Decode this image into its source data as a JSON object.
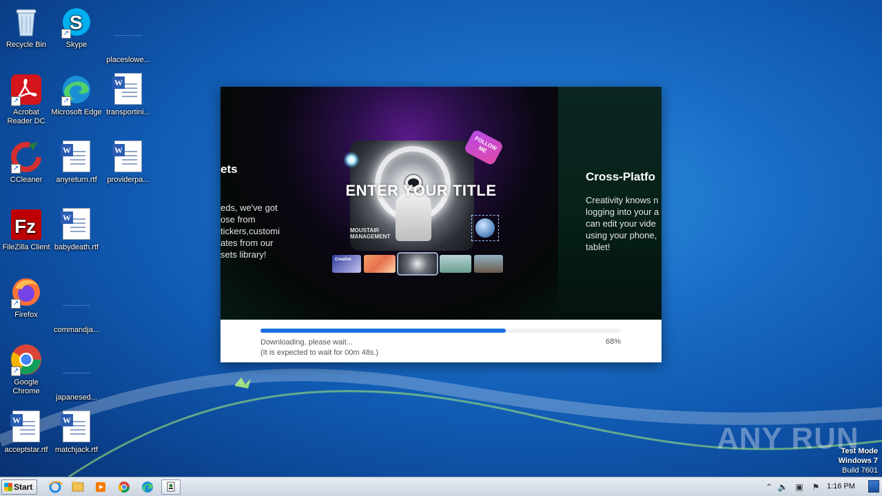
{
  "desktop": {
    "icons": [
      {
        "name": "recycle-bin",
        "label": "Recycle Bin"
      },
      {
        "name": "skype",
        "label": "Skype"
      },
      {
        "name": "placeslowe",
        "label": "placeslowe..."
      },
      {
        "name": "acrobat-reader-dc",
        "label": "Acrobat Reader DC"
      },
      {
        "name": "microsoft-edge",
        "label": "Microsoft Edge"
      },
      {
        "name": "transportini",
        "label": "transportini..."
      },
      {
        "name": "ccleaner",
        "label": "CCleaner"
      },
      {
        "name": "anyreturn",
        "label": "anyreturn.rtf"
      },
      {
        "name": "providerpa",
        "label": "providerpa..."
      },
      {
        "name": "filezilla-client",
        "label": "FileZilla Client"
      },
      {
        "name": "babydeath",
        "label": "babydeath.rtf"
      },
      {
        "name": "firefox",
        "label": "Firefox"
      },
      {
        "name": "commandja",
        "label": "commandja..."
      },
      {
        "name": "google-chrome",
        "label": "Google Chrome"
      },
      {
        "name": "japanesed",
        "label": "japanesed..."
      },
      {
        "name": "acceptstar",
        "label": "acceptstar.rtf"
      },
      {
        "name": "matchjack",
        "label": "matchjack.rtf"
      }
    ]
  },
  "installer": {
    "slide_left_heading": "ets",
    "slide_left_body": "eds, we've got\nose from\ntickers,customi\nates from our\nsets library!",
    "hero_title": "ENTER YOUR TITLE",
    "hero_sub_1": "MOUSTAIR",
    "hero_sub_2": "MANAGEMENT",
    "follow_badge_1": "FOLLOW",
    "follow_badge_2": "ME",
    "thumb_label": "Creative",
    "slide_right_heading": "Cross-Platfo",
    "slide_right_body": "Creativity knows n\nlogging into your a\ncan edit your vide\nusing your phone,\ntablet!",
    "progress_fraction": 0.68,
    "status_line_1": "Downloading, please wait...",
    "status_line_2": "(It is expected to wait for 00m 48s.)",
    "percent_text": "68%"
  },
  "watermark": {
    "brand": "ANY RUN",
    "test_mode": "Test Mode",
    "os": "Windows 7",
    "build": "Build 7601"
  },
  "taskbar": {
    "start_label": "Start",
    "clock": "1:16 PM",
    "pinned": [
      "internet-explorer",
      "windows-explorer",
      "media-player",
      "google-chrome",
      "microsoft-edge",
      "installer-app"
    ]
  },
  "colors": {
    "progress": "#1a6fe0",
    "desktop_blue": "#1565c0"
  }
}
